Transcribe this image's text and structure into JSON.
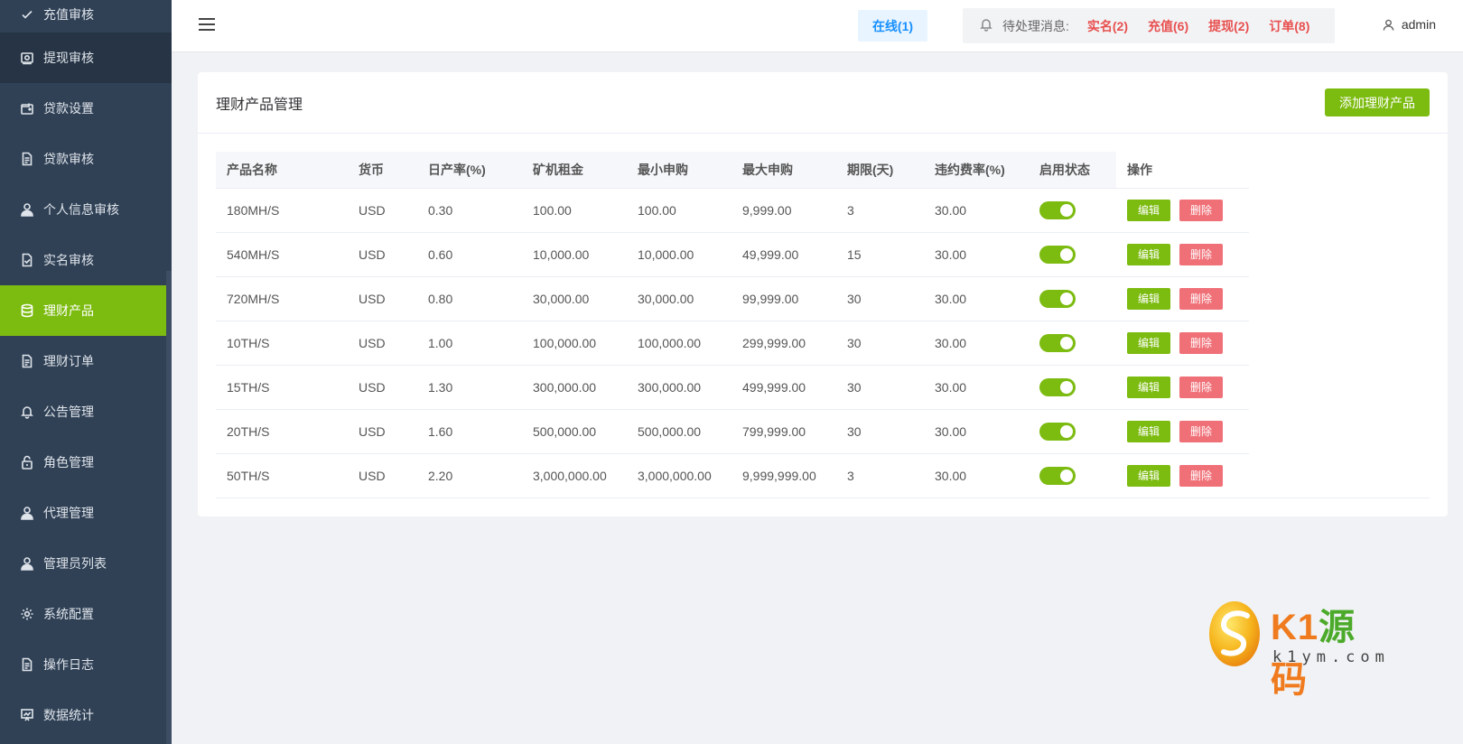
{
  "sidebar": {
    "items": [
      {
        "label": "充值审核",
        "icon": "check-icon"
      },
      {
        "label": "提现审核",
        "icon": "withdraw-icon"
      },
      {
        "label": "贷款设置",
        "icon": "wallet-icon"
      },
      {
        "label": "贷款审核",
        "icon": "document-icon"
      },
      {
        "label": "个人信息审核",
        "icon": "user-icon"
      },
      {
        "label": "实名审核",
        "icon": "document-check-icon"
      },
      {
        "label": "理财产品",
        "icon": "database-icon"
      },
      {
        "label": "理财订单",
        "icon": "document-icon"
      },
      {
        "label": "公告管理",
        "icon": "bell-icon"
      },
      {
        "label": "角色管理",
        "icon": "lock-icon"
      },
      {
        "label": "代理管理",
        "icon": "user-icon"
      },
      {
        "label": "管理员列表",
        "icon": "user-icon"
      },
      {
        "label": "系统配置",
        "icon": "gear-icon"
      },
      {
        "label": "操作日志",
        "icon": "document-icon"
      },
      {
        "label": "数据统计",
        "icon": "chart-icon"
      }
    ],
    "active_index": 6,
    "active_color": "#7cbb10"
  },
  "header": {
    "online_label": "在线(1)",
    "notice_label": "待处理消息:",
    "notice_links": [
      "实名(2)",
      "充值(6)",
      "提现(2)",
      "订单(8)"
    ],
    "user": "admin"
  },
  "card": {
    "title": "理财产品管理",
    "add_button": "添加理财产品"
  },
  "table": {
    "columns": [
      "产品名称",
      "货币",
      "日产率(%)",
      "矿机租金",
      "最小申购",
      "最大申购",
      "期限(天)",
      "违约费率(%)",
      "启用状态",
      "操作"
    ],
    "rows": [
      [
        "180MH/S",
        "USD",
        "0.30",
        "100.00",
        "100.00",
        "9,999.00",
        "3",
        "30.00"
      ],
      [
        "540MH/S",
        "USD",
        "0.60",
        "10,000.00",
        "10,000.00",
        "49,999.00",
        "15",
        "30.00"
      ],
      [
        "720MH/S",
        "USD",
        "0.80",
        "30,000.00",
        "30,000.00",
        "99,999.00",
        "30",
        "30.00"
      ],
      [
        "10TH/S",
        "USD",
        "1.00",
        "100,000.00",
        "100,000.00",
        "299,999.00",
        "30",
        "30.00"
      ],
      [
        "15TH/S",
        "USD",
        "1.30",
        "300,000.00",
        "300,000.00",
        "499,999.00",
        "30",
        "30.00"
      ],
      [
        "20TH/S",
        "USD",
        "1.60",
        "500,000.00",
        "500,000.00",
        "799,999.00",
        "30",
        "30.00"
      ],
      [
        "50TH/S",
        "USD",
        "2.20",
        "3,000,000.00",
        "3,000,000.00",
        "9,999,999.00",
        "3",
        "30.00"
      ]
    ],
    "enabled": [
      true,
      true,
      true,
      true,
      true,
      true,
      true
    ],
    "edit_label": "编辑",
    "delete_label": "删除"
  },
  "watermark": {
    "brand": "K1源码",
    "url": "k1ym.com"
  }
}
